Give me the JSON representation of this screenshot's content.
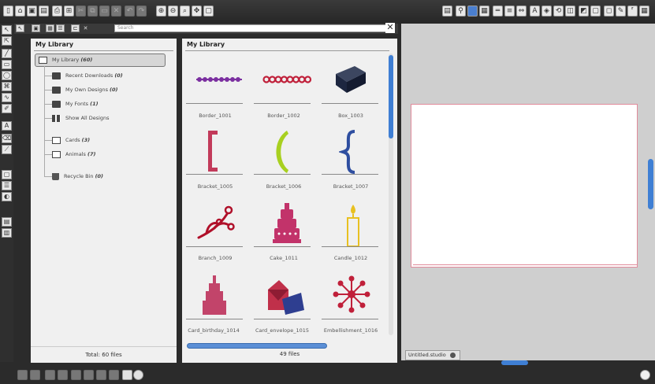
{
  "search": {
    "placeholder": "Search"
  },
  "library": {
    "title": "My Library",
    "root": {
      "label": "My Library",
      "count": "(60)"
    },
    "items": [
      {
        "label": "Recent Downloads",
        "count": "(0)"
      },
      {
        "label": "My Own Designs",
        "count": "(0)"
      },
      {
        "label": "My Fonts",
        "count": "(1)"
      },
      {
        "label": "Show All Designs",
        "count": ""
      },
      {
        "label": "Cards",
        "count": "(3)"
      },
      {
        "label": "Animals",
        "count": "(7)"
      },
      {
        "label": "Recycle Bin",
        "count": "(0)"
      }
    ],
    "total": "Total: 60 files"
  },
  "grid": {
    "title": "My Library",
    "designs": [
      {
        "label": "Border_1001",
        "icon": "border-beads-icon",
        "color": "#7b2fa0"
      },
      {
        "label": "Border_1002",
        "icon": "border-rings-icon",
        "color": "#c0203a"
      },
      {
        "label": "Box_1003",
        "icon": "box-icon",
        "color": "#1d2640"
      },
      {
        "label": "Bracket_1005",
        "icon": "square-bracket-icon",
        "color": "#c23a5a"
      },
      {
        "label": "Bracket_1006",
        "icon": "paren-icon",
        "color": "#a8d020"
      },
      {
        "label": "Bracket_1007",
        "icon": "curly-brace-icon",
        "color": "#2e4ea0"
      },
      {
        "label": "Branch_1009",
        "icon": "branch-icon",
        "color": "#b0102a"
      },
      {
        "label": "Cake_1011",
        "icon": "cake-icon",
        "color": "#c2336a"
      },
      {
        "label": "Candle_1012",
        "icon": "candle-icon",
        "color": "#e8c020"
      },
      {
        "label": "Card_birthday_1014",
        "icon": "birthday-card-icon",
        "color": "#c2446a"
      },
      {
        "label": "Card_envelope_1015",
        "icon": "envelope-card-icon",
        "color": "#c0304a"
      },
      {
        "label": "Embellishment_1016",
        "icon": "embellishment-icon",
        "color": "#c0203a"
      }
    ],
    "total": "49 files"
  },
  "document": {
    "tab_label": "Untitled.studio"
  },
  "colors": {
    "accent": "#3f7fd4",
    "page_border": "#e08a9a"
  }
}
